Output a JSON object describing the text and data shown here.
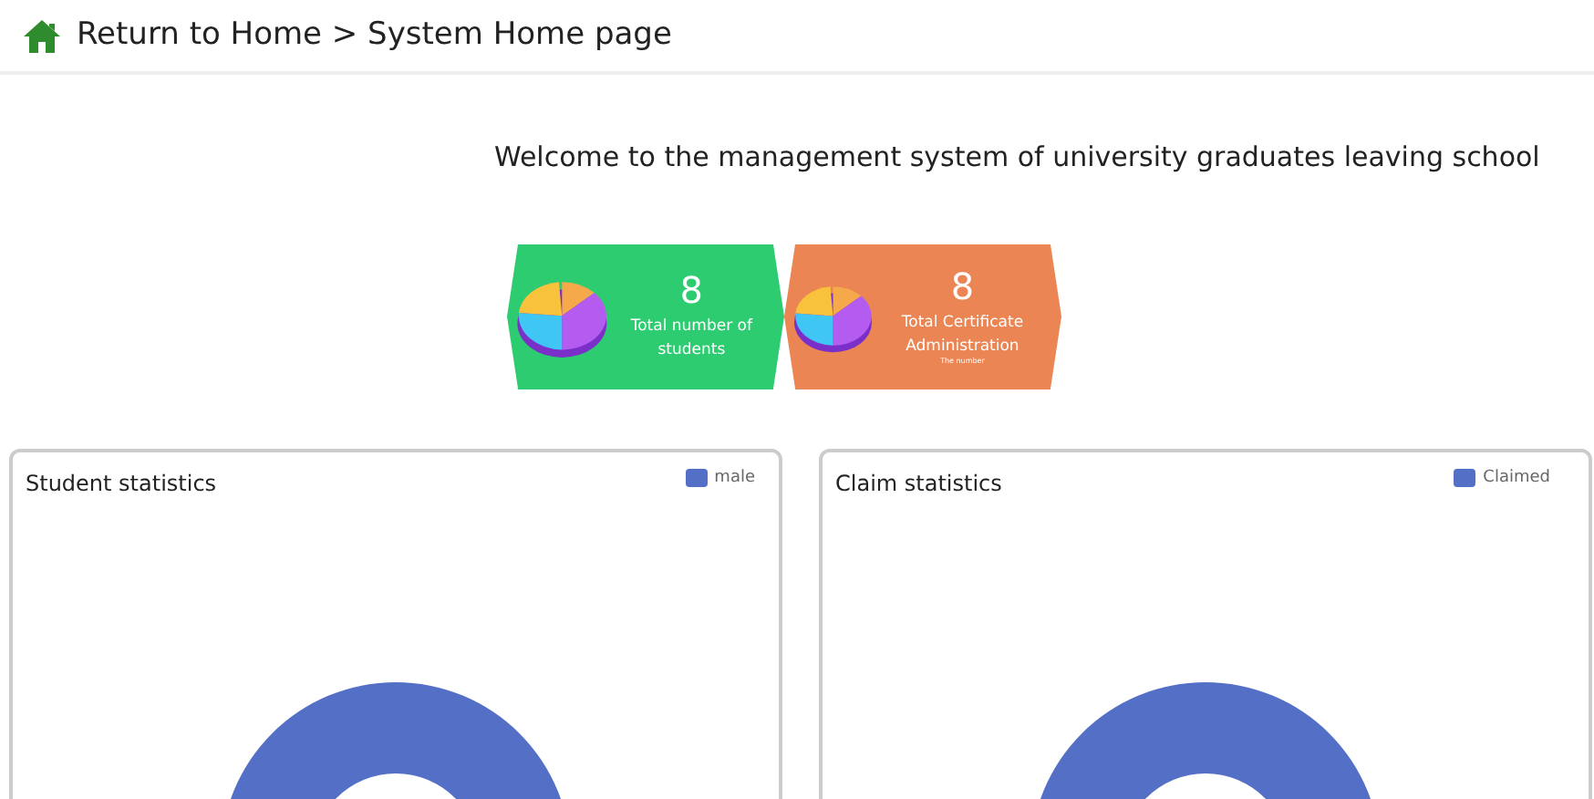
{
  "header": {
    "breadcrumb": "Return to Home > System Home page"
  },
  "welcome": "Welcome to the management system of university graduates leaving school",
  "tiles": [
    {
      "value": "8",
      "label": "Total number of students",
      "color": "#2ecc71"
    },
    {
      "value": "8",
      "label": "Total Certificate Administration",
      "note": "The number",
      "color": "#eb8553"
    }
  ],
  "cards": [
    {
      "title": "Student statistics",
      "legend": [
        {
          "label": "male",
          "color": "#5470c6"
        }
      ]
    },
    {
      "title": "Claim statistics",
      "legend": [
        {
          "label": "Claimed",
          "color": "#5470c6"
        }
      ]
    }
  ]
}
